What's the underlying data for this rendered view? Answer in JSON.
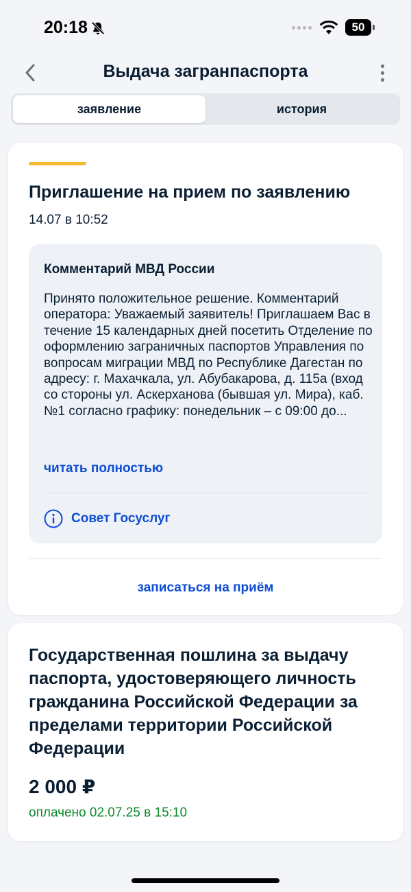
{
  "status_bar": {
    "time": "20:18",
    "battery": "50",
    "battery_level_percent": 50
  },
  "header": {
    "title": "Выдача загранпаспорта"
  },
  "tabs": [
    {
      "label": "заявление",
      "active": true
    },
    {
      "label": "история",
      "active": false
    }
  ],
  "invitation": {
    "title": "Приглашение на прием по заявлению",
    "date": "14.07 в 10:52",
    "accent_color": "#f5b82e",
    "comment": {
      "title": "Комментарий МВД России",
      "text": "Принято положительное решение. Комментарий оператора: Уважаемый заявитель! Приглашаем Вас в течение 15 календарных дней посетить Отделение по оформлению заграничных паспортов Управления по вопросам миграции МВД по Республике Дагестан по адресу: г. Махачкала, ул. Абубакарова, д. 115а (вход со стороны ул. Аскерханова (бывшая ул. Мира), каб.№1 согласно графику: понедельник – с 09:00 до...",
      "read_more": "читать полностью",
      "advice_label": "Совет Госуслуг"
    },
    "book_link": "записаться на приём"
  },
  "fee": {
    "title": "Государственная пошлина за выдачу паспорта, удостоверяющего личность гражданина Российской Федерации за пределами территории Российской Федерации",
    "amount": "2 000 ₽",
    "status": "оплачено 02.07.25 в 15:10",
    "status_color": "#0f8a2a"
  },
  "colors": {
    "link": "#0d4cd3",
    "text": "#0b1f33",
    "background": "#f3f5f8"
  }
}
